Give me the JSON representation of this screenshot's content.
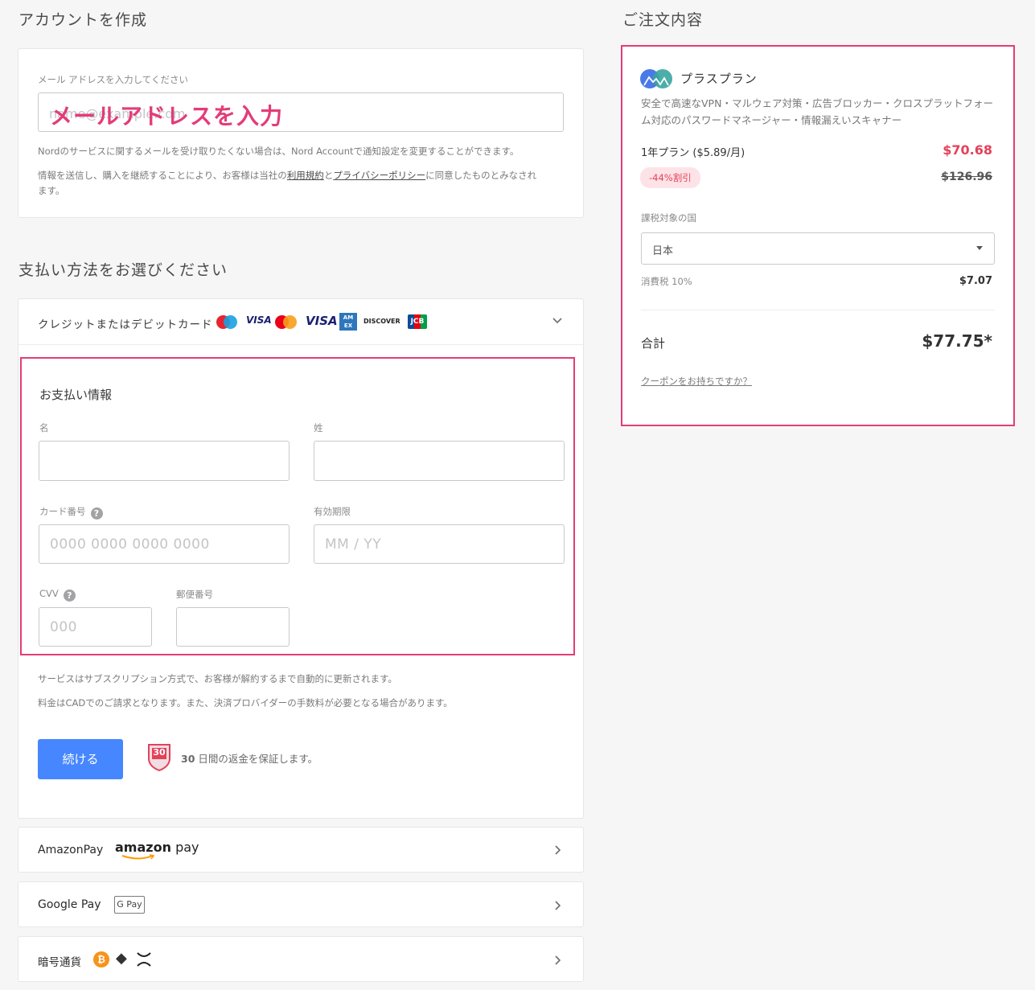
{
  "account": {
    "heading": "アカウントを作成",
    "email_label": "メール アドレスを入力してください",
    "email_placeholder": "name@example.com",
    "email_overlay": "メールアドレスを入力",
    "notice1": "Nordのサービスに関するメールを受け取りたくない場合は、Nord Accountで通知設定を変更することができます。",
    "notice2_pre": "情報を送信し、購入を継続することにより、お客様は当社の",
    "terms_link": "利用規約",
    "notice2_mid": "と",
    "privacy_link": "プライバシーポリシー",
    "notice2_post": "に同意したものとみなされ",
    "notice2_end": "ます。"
  },
  "payment": {
    "heading": "支払い方法をお選びください",
    "card_method_label": "クレジットまたはデビットカード",
    "card_logos": {
      "visa1": "VISA",
      "visa2": "VISA",
      "amex": "AM EX",
      "discover": "DISCOVER",
      "jcb": "JCB"
    },
    "info_heading": "お支払い情報",
    "first_name_label": "名",
    "last_name_label": "姓",
    "card_number_label": "カード番号",
    "card_number_placeholder": "0000 0000 0000 0000",
    "expiry_label": "有効期限",
    "expiry_placeholder": "MM / YY",
    "cvv_label": "CVV",
    "cvv_placeholder": "000",
    "zip_label": "郵便番号",
    "note1": "サービスはサブスクリプション方式で、お客様が解約するまで自動的に更新されます。",
    "note2": "料金はCADでのご請求となります。また、決済プロバイダーの手数料が必要となる場合があります。",
    "continue_button": "続ける",
    "badge_number": "30",
    "guarantee_num": "30",
    "guarantee_text": " 日間の返金を保証します。",
    "amazon_label": "AmazonPay",
    "amazon_logo_a": "amazon",
    "amazon_logo_b": "pay",
    "google_label": "Google Pay",
    "gpay_logo": "G Pay",
    "crypto_label": "暗号通貨",
    "crypto_btc": "₿",
    "crypto_eth": "◆"
  },
  "order": {
    "heading": "ご注文内容",
    "plan_name": "プラスプラン",
    "plan_desc": "安全で高速なVPN・マルウェア対策・広告ブロッカー・クロスプラットフォーム対応のパスワードマネージャー・情報漏えいスキャナー",
    "term_label": "1年プラン ($5.89/月)",
    "price": "$70.68",
    "discount_badge": "-44%割引",
    "original_price": "$126.96",
    "country_label": "課税対象の国",
    "country_value": "日本",
    "tax_label": "消費税 10%",
    "tax_value": "$7.07",
    "total_label": "合計",
    "total_value": "$77.75*",
    "coupon_link": "クーポンをお持ちですか？"
  },
  "colors": {
    "accent": "#e33c78",
    "button": "#4687ff",
    "price_red": "#e5415a"
  }
}
